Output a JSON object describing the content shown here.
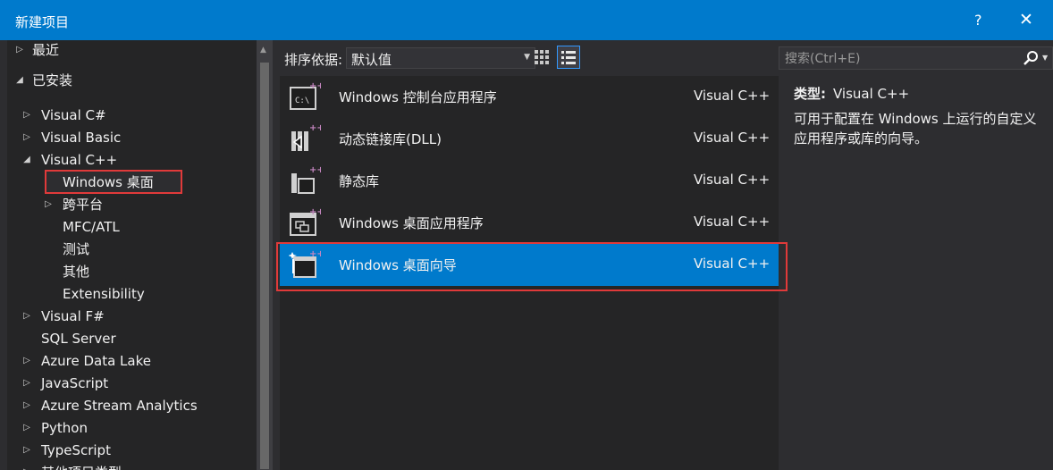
{
  "window": {
    "title": "新建项目",
    "help": "?",
    "close": "✕"
  },
  "tree": {
    "recent": "最近",
    "installed": "已安装",
    "items": [
      {
        "label": "Visual C#",
        "arrow": "▷"
      },
      {
        "label": "Visual Basic",
        "arrow": "▷"
      },
      {
        "label": "Visual C++",
        "arrow": "◢"
      },
      {
        "label": "Windows 桌面",
        "arrow": ""
      },
      {
        "label": "跨平台",
        "arrow": "▷"
      },
      {
        "label": "MFC/ATL",
        "arrow": ""
      },
      {
        "label": "测试",
        "arrow": ""
      },
      {
        "label": "其他",
        "arrow": ""
      },
      {
        "label": "Extensibility",
        "arrow": ""
      },
      {
        "label": "Visual F#",
        "arrow": "▷"
      },
      {
        "label": "SQL Server",
        "arrow": ""
      },
      {
        "label": "Azure Data Lake",
        "arrow": "▷"
      },
      {
        "label": "JavaScript",
        "arrow": "▷"
      },
      {
        "label": "Azure Stream Analytics",
        "arrow": "▷"
      },
      {
        "label": "Python",
        "arrow": "▷"
      },
      {
        "label": "TypeScript",
        "arrow": "▷"
      },
      {
        "label": "其他项目类型",
        "arrow": "▷"
      }
    ],
    "selected": "Windows 桌面"
  },
  "sort": {
    "label": "排序依据:",
    "value": "默认值"
  },
  "templates": [
    {
      "name": "Windows 控制台应用程序",
      "lang": "Visual C++",
      "icon": "console-app-icon"
    },
    {
      "name": "动态链接库(DLL)",
      "lang": "Visual C++",
      "icon": "dll-icon"
    },
    {
      "name": "静态库",
      "lang": "Visual C++",
      "icon": "static-lib-icon"
    },
    {
      "name": "Windows 桌面应用程序",
      "lang": "Visual C++",
      "icon": "desktop-app-icon"
    },
    {
      "name": "Windows 桌面向导",
      "lang": "Visual C++",
      "icon": "desktop-wizard-icon"
    }
  ],
  "selected_template": "Windows 桌面向导",
  "search": {
    "placeholder": "搜索(Ctrl+E)"
  },
  "detail": {
    "type_label": "类型:",
    "type_value": "Visual C++",
    "description": "可用于配置在 Windows 上运行的自定义应用程序或库的向导。"
  },
  "colors": {
    "accent": "#007acc",
    "highlight": "#e03a3a",
    "background": "#2d2d30"
  }
}
